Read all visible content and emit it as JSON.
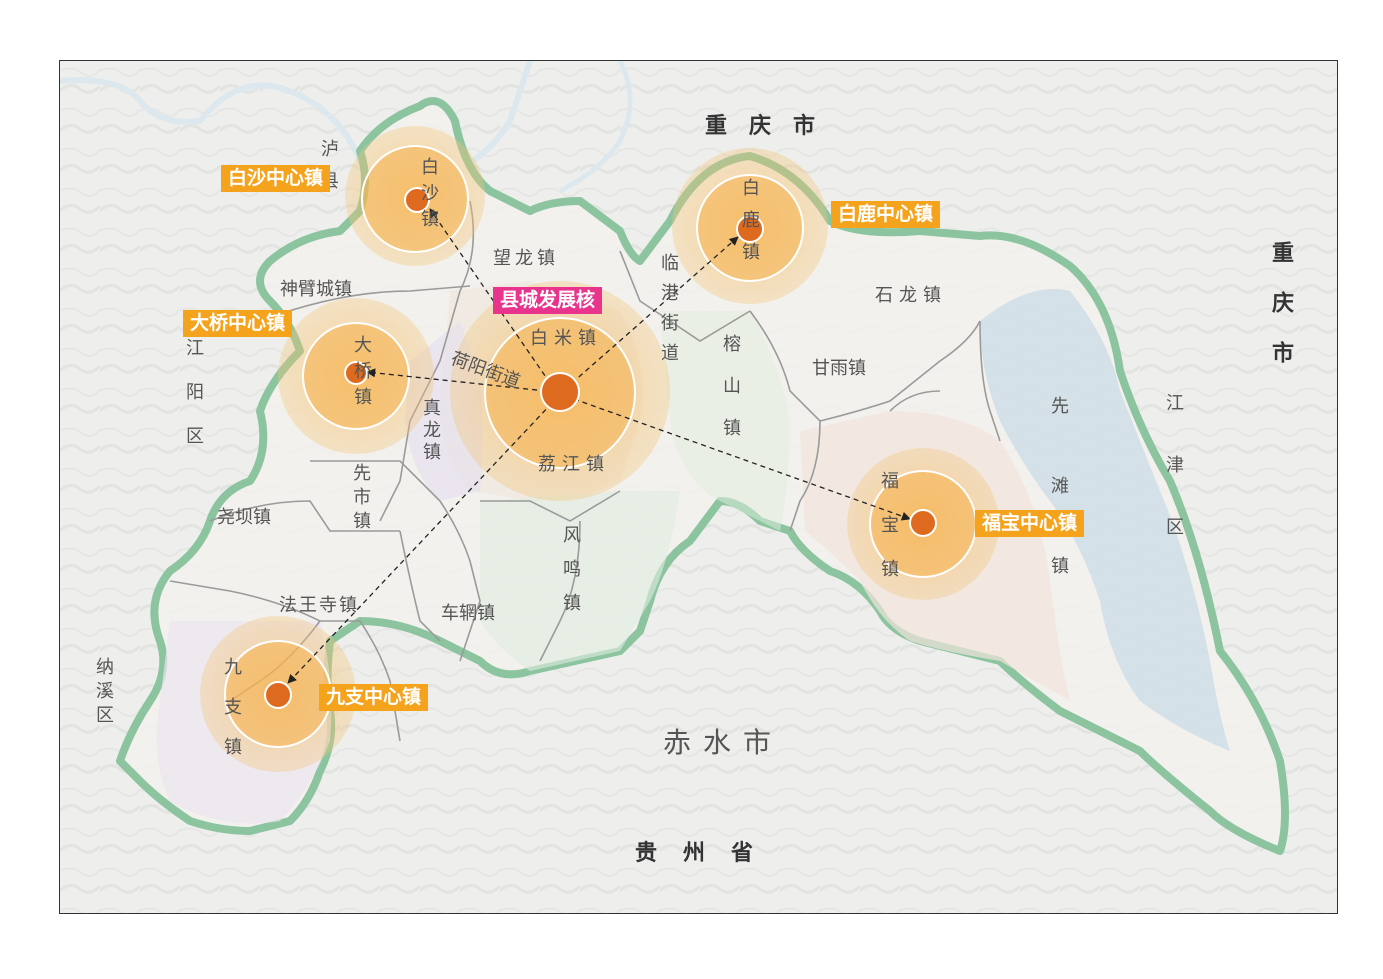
{
  "regions": {
    "chongqing_top": "重庆市",
    "chongqing_right": "重庆市",
    "guizhou": "贵州省",
    "chishui": "赤水市",
    "luxian": "泸县",
    "jiangyang": "江阳区",
    "naxi": "纳溪区",
    "jiangjin": "江津区"
  },
  "towns": {
    "wanglong": "望龙镇",
    "shenbicheng": "神臂城镇",
    "baimi": "白米镇",
    "lingang": "临港街道",
    "rongshan": "榕山镇",
    "shilong": "石龙镇",
    "ganyu": "甘雨镇",
    "xiantan": "先滩镇",
    "fubao": "福宝镇",
    "fuyang": "荷阳街道",
    "zhenlong": "真龙镇",
    "lijiang": "荔江镇",
    "xianshi": "先市镇",
    "yaoba": "尧坝镇",
    "fengming": "风鸣镇",
    "chexin": "车辋镇",
    "fawangsi": "法王寺镇",
    "jiuzhi": "九支镇",
    "baisha": "白沙镇",
    "bailu": "白鹿镇",
    "daqiao": "大桥镇"
  },
  "centers": {
    "core": "县城发展核",
    "baisha": "白沙中心镇",
    "bailu": "白鹿中心镇",
    "daqiao": "大桥中心镇",
    "fubao": "福宝中心镇",
    "jiuzhi": "九支中心镇"
  },
  "colors": {
    "boundary": "#8cc4a0",
    "halo": "#f5a21d",
    "dot": "#de6a1f",
    "core_label": "#e8348c",
    "center_label": "#f5a21d",
    "lake": "#c9dbe6"
  }
}
